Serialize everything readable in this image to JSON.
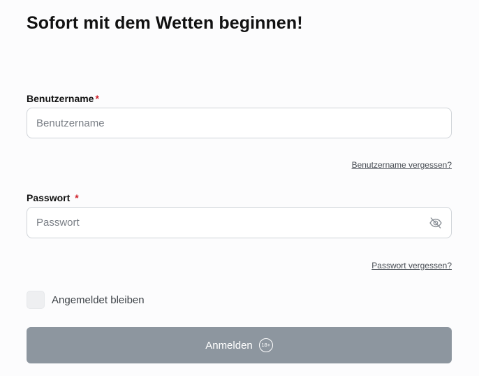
{
  "form": {
    "title": "Sofort mit dem Wetten beginnen!",
    "username": {
      "label": "Benutzername",
      "required_mark": "*",
      "placeholder": "Benutzername",
      "value": "",
      "forgot_link": "Benutzername vergessen?"
    },
    "password": {
      "label": "Passwort",
      "required_mark": "*",
      "placeholder": "Passwort",
      "value": "",
      "toggle_icon": "eye-slash-icon",
      "forgot_link": "Passwort vergessen?"
    },
    "remember_me": {
      "label": "Angemeldet bleiben",
      "checked": false
    },
    "submit": {
      "label": "Anmelden",
      "age_badge": "18+"
    }
  },
  "colors": {
    "required": "#d0202a",
    "button_bg": "#8d969f",
    "field_border": "#cfd3d8",
    "link": "#4a4f56"
  }
}
